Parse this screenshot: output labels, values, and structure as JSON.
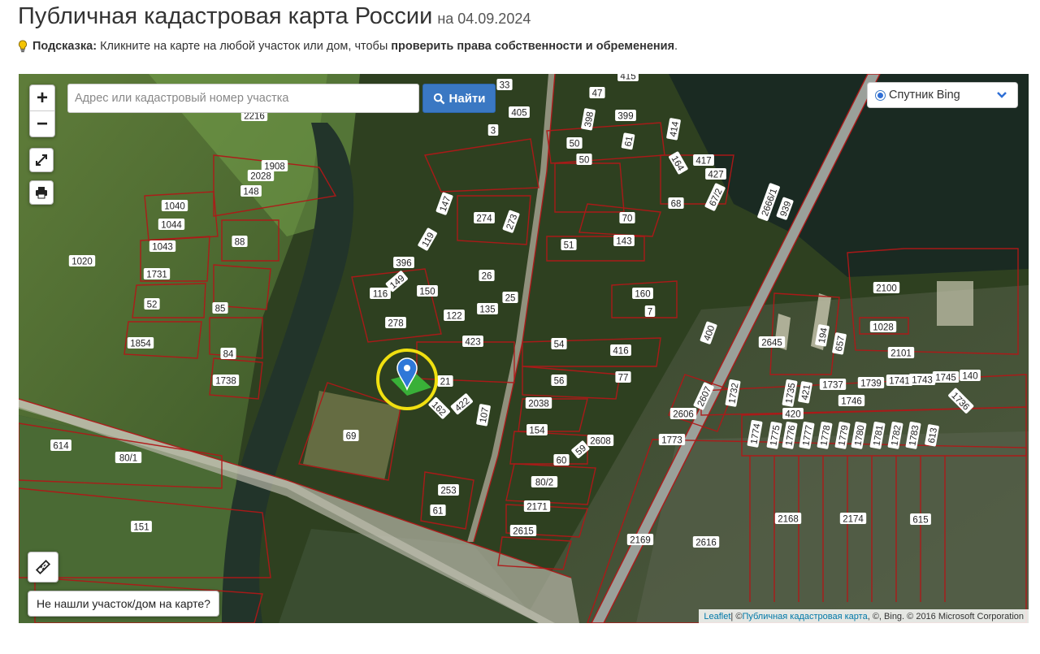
{
  "header": {
    "title": "Публичная кадастровая карта России",
    "date": "на 04.09.2024"
  },
  "hint": {
    "label": "Подсказка:",
    "text": "Кликните на карте на любой участок или дом, чтобы",
    "bold": "проверить права собственности и обременения",
    "end": "."
  },
  "map": {
    "zoom_in": "+",
    "zoom_out": "−",
    "search_placeholder": "Адрес или кадастровый номер участка",
    "search_value": "",
    "find_label": "Найти",
    "layer_label": "Спутник Bing",
    "not_found": "Не нашли участок/дом на карте?",
    "attribution": {
      "leaflet": "Leaflet",
      "sep": " | © ",
      "pkk": "Публичная кадастровая карта",
      "rest": ", ©, Bing. © 2016 Microsoft Corporation"
    },
    "icons": [
      "search-icon",
      "fullscreen-icon",
      "print-icon",
      "ruler-icon",
      "chevron-down-icon",
      "marker-icon",
      "bulb-icon"
    ],
    "colors": {
      "parcel": "#b01818",
      "button": "#3a78c3",
      "marker_ring": "#f0e010",
      "marker_pin": "#2f78d8"
    },
    "parcels": [
      "2216",
      "33",
      "415",
      "47",
      "405",
      "3",
      "398",
      "399",
      "414",
      "1908",
      "2028",
      "148",
      "50",
      "50",
      "61",
      "164",
      "417",
      "427",
      "67/2",
      "1040",
      "147",
      "274",
      "273",
      "68",
      "70",
      "939",
      "2666/1",
      "1044",
      "119",
      "143",
      "1043",
      "88",
      "51",
      "1020",
      "396",
      "26",
      "149",
      "160",
      "1731",
      "150",
      "116",
      "25",
      "52",
      "85",
      "135",
      "122",
      "7",
      "2100",
      "278",
      "1028",
      "423",
      "400",
      "2645",
      "194",
      "657",
      "1854",
      "54",
      "416",
      "2101",
      "84",
      "77",
      "21",
      "56",
      "1732",
      "1735",
      "1737",
      "1739",
      "1741",
      "1743",
      "1745",
      "140",
      "1738",
      "1746",
      "1736",
      "421",
      "422",
      "162",
      "2038",
      "2607",
      "2606",
      "420",
      "107",
      "69",
      "154",
      "2608",
      "1773",
      "1774",
      "1775",
      "1776",
      "1777",
      "1778",
      "1779",
      "1780",
      "1781",
      "1782",
      "1783",
      "613",
      "614",
      "80/1",
      "59",
      "60",
      "80/2",
      "253",
      "61",
      "2171",
      "2168",
      "2174",
      "615",
      "151",
      "2615",
      "2169",
      "2616"
    ]
  }
}
